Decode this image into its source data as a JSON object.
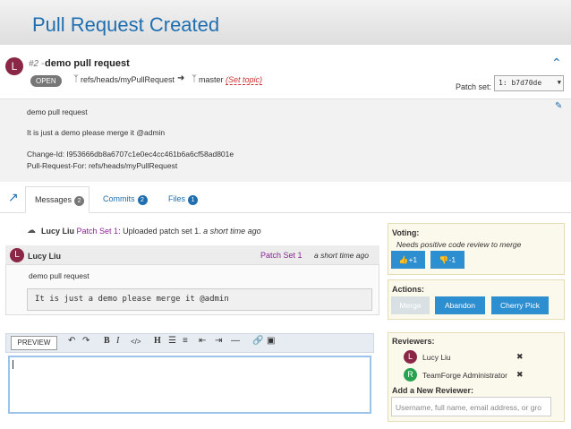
{
  "slide": {
    "title": "Pull Request Created"
  },
  "pr": {
    "author_initial": "L",
    "number": "#2 -",
    "title": "demo pull request",
    "status": "OPEN",
    "source_branch": "refs/heads/myPullRequest",
    "target_branch": "master",
    "set_topic": "(Set topic)",
    "patch_set_label": "Patch set:",
    "patch_set_value": "1: b7d70de",
    "description": [
      "demo pull request",
      "It is just a demo please merge it @admin",
      "Change-Id: I953666db8a6707c1e0ec4cc461b6a6cf58ad801e",
      "Pull-Request-For: refs/heads/myPullRequest"
    ]
  },
  "tabs": [
    {
      "label": "Messages",
      "count": "2"
    },
    {
      "label": "Commits",
      "count": "2"
    },
    {
      "label": "Files",
      "count": "1"
    }
  ],
  "activity": {
    "author": "Lucy Liu",
    "patch_set": "Patch Set 1",
    "text": ": Uploaded patch set 1.",
    "time": "a short time ago"
  },
  "message": {
    "author_initial": "L",
    "author": "Lucy Liu",
    "patch_set": "Patch Set 1",
    "time": "a short time ago",
    "title": "demo pull request",
    "body": "It is just a demo please merge it @admin"
  },
  "editor": {
    "preview_label": "PREVIEW"
  },
  "voting": {
    "title": "Voting:",
    "note": "Needs positive code review to merge",
    "plus": "+1",
    "minus": "-1"
  },
  "actions": {
    "title": "Actions:",
    "merge": "Merge",
    "abandon": "Abandon",
    "cherry_pick": "Cherry Pick"
  },
  "reviewers": {
    "title": "Reviewers:",
    "list": [
      {
        "initial": "L",
        "name": "Lucy Liu",
        "color": "#8a2747"
      },
      {
        "initial": "R",
        "name": "TeamForge Administrator",
        "color": "#27a34f"
      }
    ],
    "add_title": "Add a New Reviewer:",
    "add_placeholder": "Username, full name, email address, or gro"
  },
  "colors": {
    "accent": "#1f6fb0",
    "button": "#2d8ed0",
    "author": "#8a2747"
  }
}
